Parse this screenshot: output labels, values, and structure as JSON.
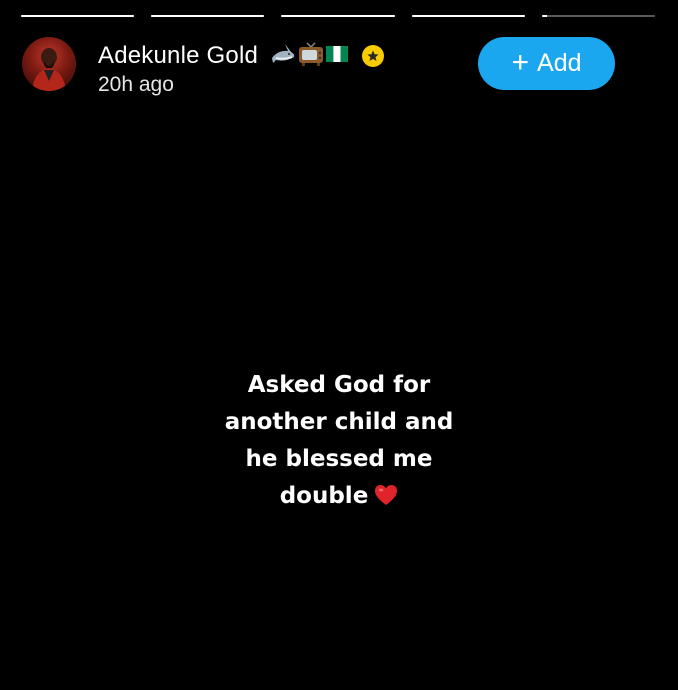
{
  "story": {
    "segments": [
      {
        "progress": 1.0
      },
      {
        "progress": 1.0
      },
      {
        "progress": 1.0
      },
      {
        "progress": 1.0
      },
      {
        "progress": 0.05
      }
    ]
  },
  "header": {
    "name": "Adekunle Gold",
    "time": "20h ago",
    "emojis": [
      "shark-icon",
      "television-icon",
      "nigeria-flag-icon"
    ],
    "badge_icon": "star-badge-icon",
    "badge_color": "#f7cc00"
  },
  "actions": {
    "add_label": "Add",
    "add_icon": "plus-icon",
    "add_color": "#1aa7f0"
  },
  "caption": {
    "line1": "Asked God for",
    "line2": "another child and",
    "line3": "he blessed me",
    "line4": "double",
    "heart_icon": "red-heart-icon"
  }
}
